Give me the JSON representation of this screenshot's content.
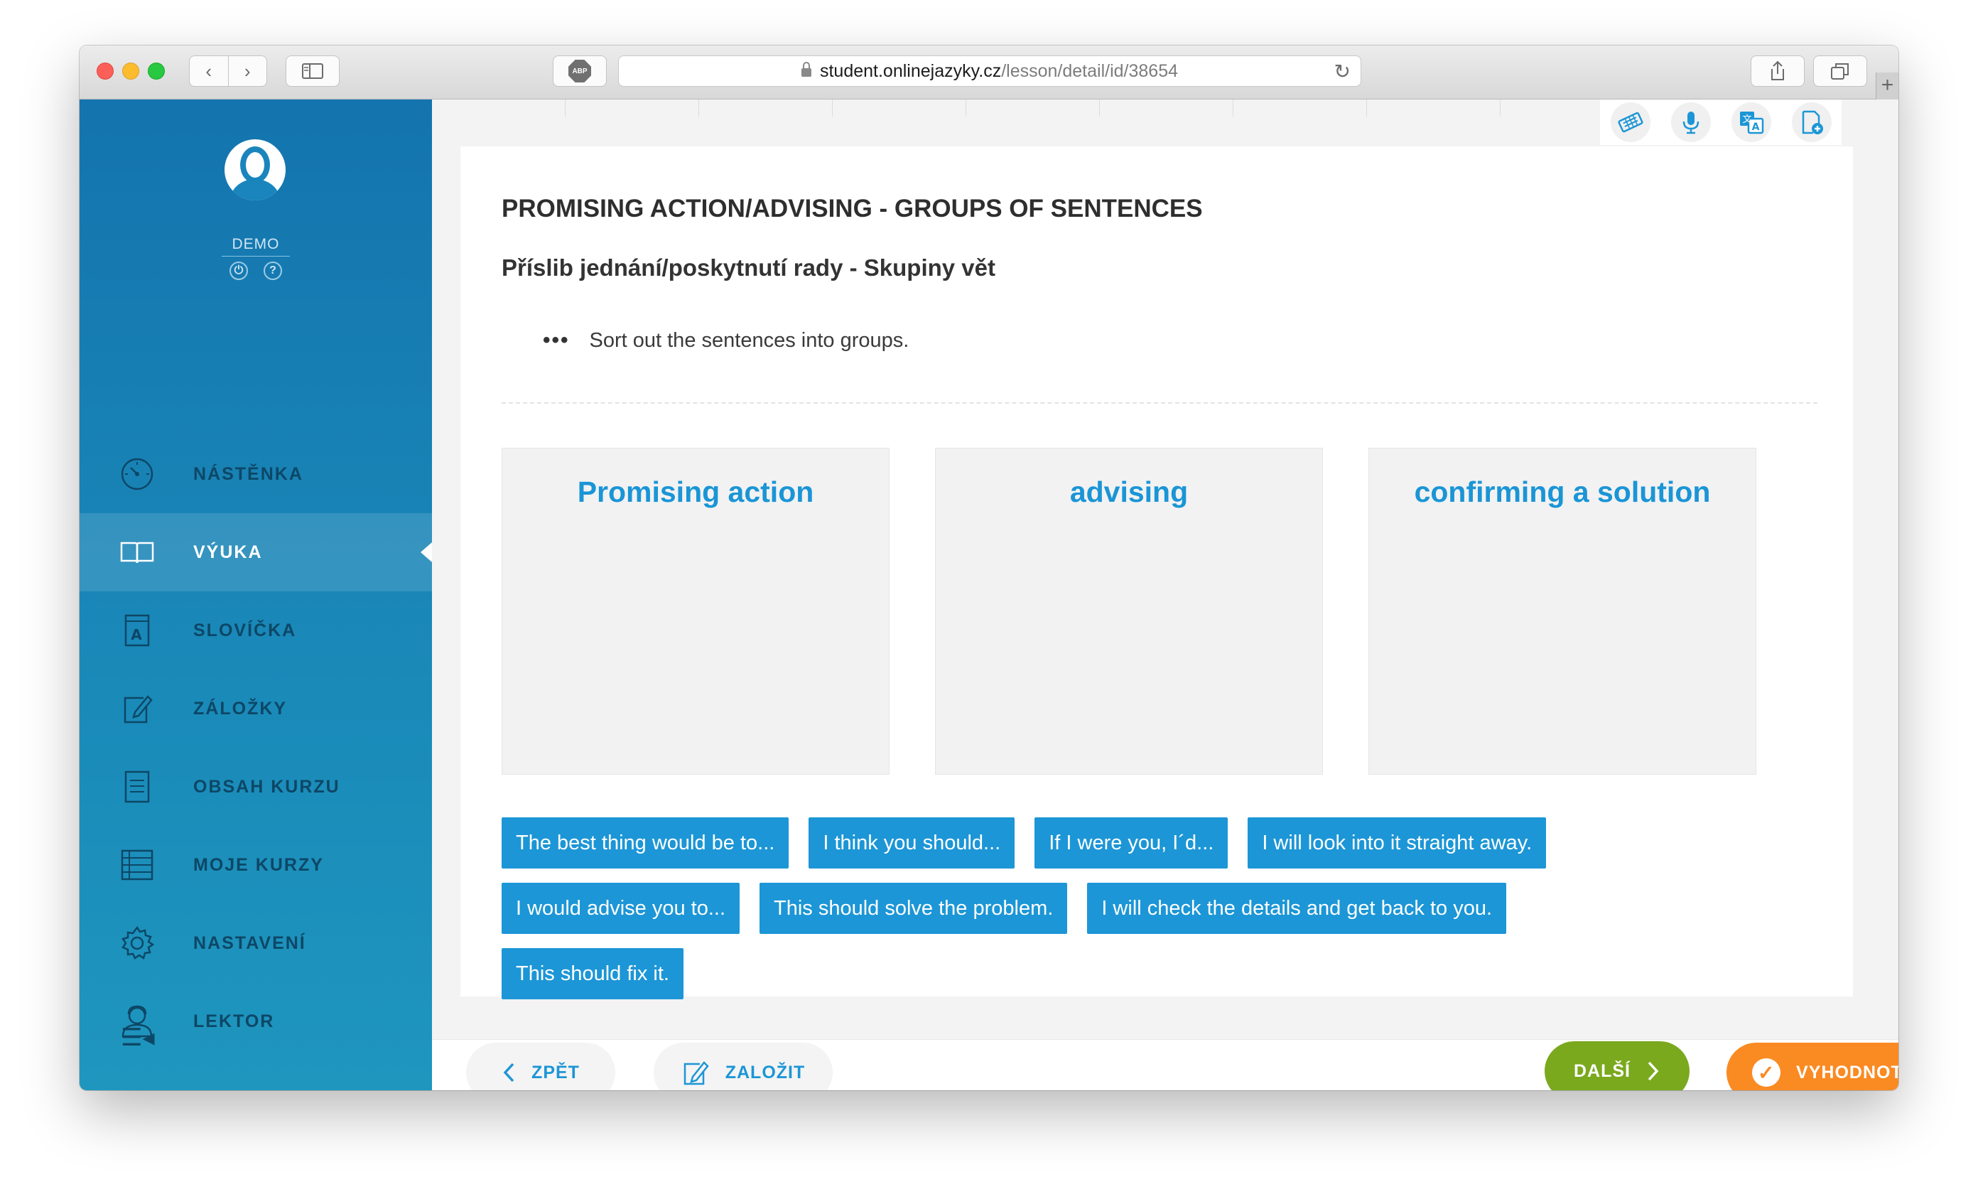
{
  "browser": {
    "url_host": "student.onlinejazyky.cz",
    "url_path": "/lesson/detail/id/38654",
    "abp_label": "ABP"
  },
  "sidebar": {
    "username": "DEMO",
    "items": [
      {
        "label": "NÁSTĚNKA",
        "icon": "dashboard-icon",
        "active": false
      },
      {
        "label": "VÝUKA",
        "icon": "book-icon",
        "active": true
      },
      {
        "label": "SLOVÍČKA",
        "icon": "vocabulary-icon",
        "active": false
      },
      {
        "label": "ZÁLOŽKY",
        "icon": "bookmark-edit-icon",
        "active": false
      },
      {
        "label": "OBSAH KURZU",
        "icon": "document-list-icon",
        "active": false
      },
      {
        "label": "MOJE KURZY",
        "icon": "course-list-icon",
        "active": false
      },
      {
        "label": "NASTAVENÍ",
        "icon": "gear-icon",
        "active": false
      },
      {
        "label": "LEKTOR",
        "icon": "tutor-icon",
        "active": false
      }
    ]
  },
  "lesson": {
    "title_en": "PROMISING ACTION/ADVISING - GROUPS OF SENTENCES",
    "title_cz": "Příslib jednání/poskytnutí rady - Skupiny vět",
    "instruction": "Sort out the sentences into groups.",
    "groups": [
      "Promising action",
      "advising",
      "confirming a solution"
    ],
    "chip_rows": [
      [
        "The best thing would be to...",
        "I think you should...",
        "If I were you, I´d...",
        "I will look into it straight away."
      ],
      [
        "I would advise you to...",
        "This should solve the problem.",
        "I will check the details and get back to you."
      ],
      [
        "This should fix it."
      ]
    ]
  },
  "footer": {
    "back_label": "ZPĚT",
    "bookmark_label": "ZALOŽIT",
    "next_label": "DALŠÍ",
    "evaluate_label": "VYHODNOTIT"
  },
  "colors": {
    "sidebar": "#1a85bd",
    "accent_blue": "#1c96d6",
    "next_green": "#7aa91e",
    "evaluate_orange": "#fa8a22"
  }
}
